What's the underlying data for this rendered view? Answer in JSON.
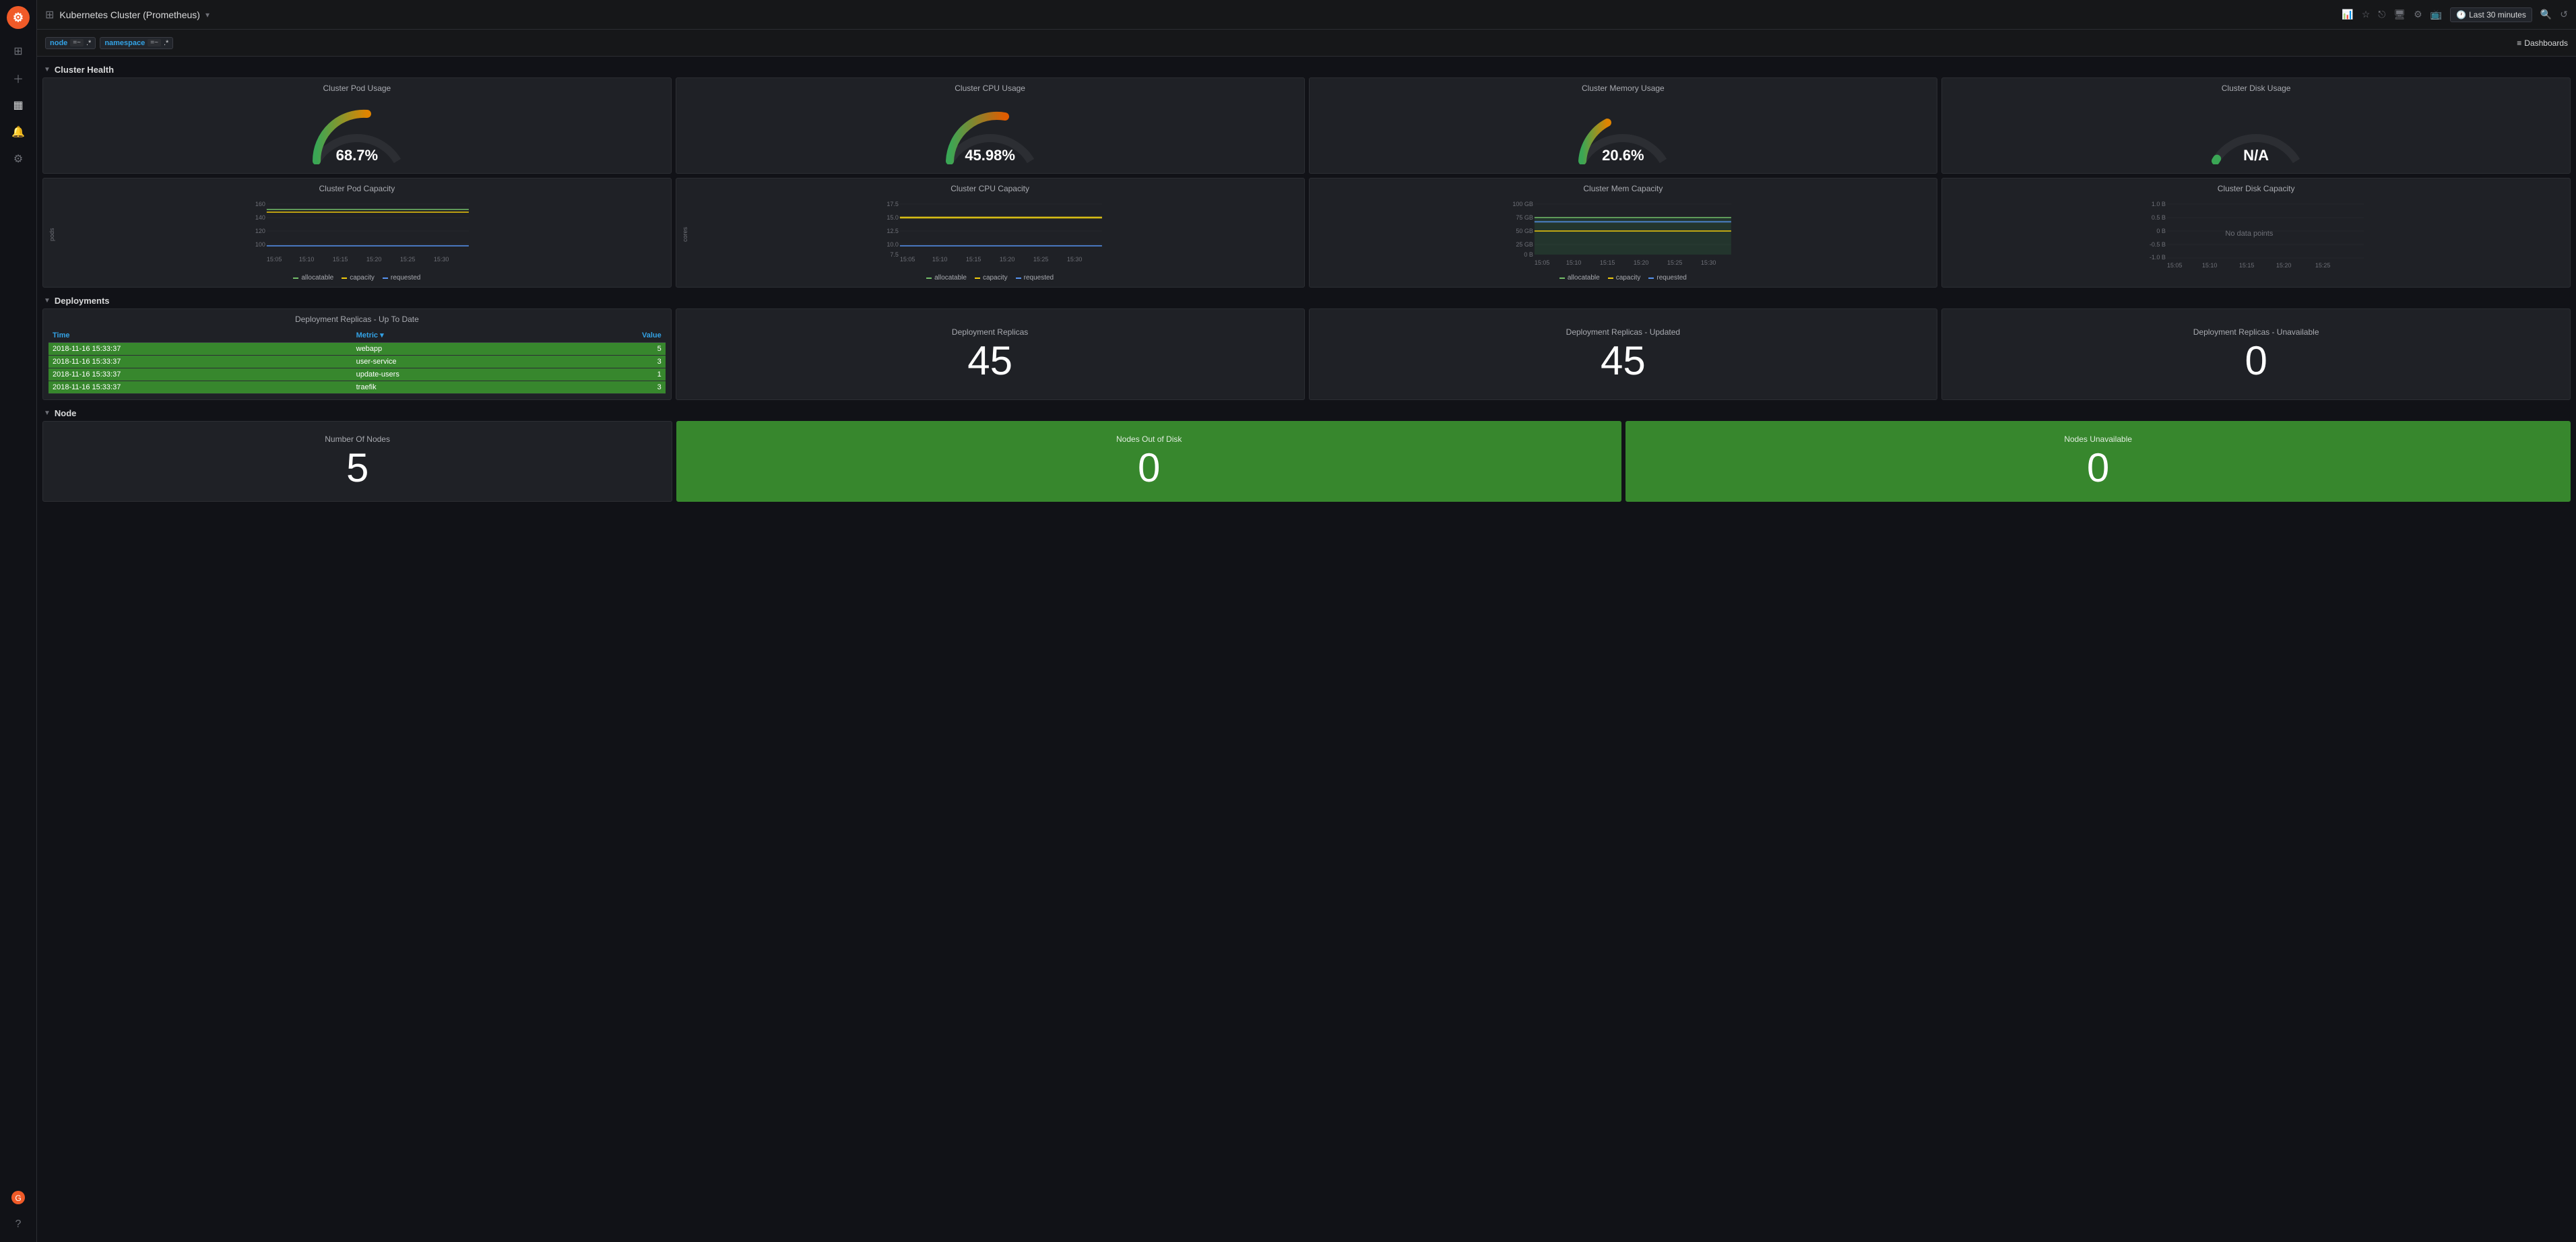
{
  "app": {
    "title": "Kubernetes Cluster (Prometheus)",
    "title_dropdown": "▾",
    "time_range": "Last 30 minutes"
  },
  "sidebar": {
    "icons": [
      "grid",
      "plus",
      "squares",
      "bell",
      "gear",
      "fire-icon",
      "question-icon"
    ]
  },
  "filterbar": {
    "filter1_key": "node",
    "filter1_op": "=~",
    "filter1_val": ".*",
    "filter2_key": "namespace",
    "filter2_op": "=~",
    "filter2_val": ".*",
    "dashboards_label": "Dashboards"
  },
  "sections": {
    "cluster_health": {
      "label": "Cluster Health",
      "gauges": [
        {
          "title": "Cluster Pod Usage",
          "value": "68.7%",
          "pct": 68.7,
          "color_start": "#3aa655",
          "color_end": "#e08400"
        },
        {
          "title": "Cluster CPU Usage",
          "value": "45.98%",
          "pct": 45.98,
          "color_start": "#3aa655",
          "color_end": "#e05c00"
        },
        {
          "title": "Cluster Memory Usage",
          "value": "20.6%",
          "pct": 20.6,
          "color_start": "#3aa655",
          "color_end": "#e08400"
        },
        {
          "title": "Cluster Disk Usage",
          "value": "N/A",
          "pct": null,
          "color_start": "#3aa655",
          "color_end": "#e08400"
        }
      ],
      "charts": [
        {
          "title": "Cluster Pod Capacity",
          "y_axis_label": "pods",
          "y_ticks": [
            "100",
            "120",
            "140",
            "160"
          ],
          "x_ticks": [
            "15:05",
            "15:10",
            "15:15",
            "15:20",
            "15:25",
            "15:30"
          ],
          "legend": [
            {
              "label": "allocatable",
              "color": "#73bf69"
            },
            {
              "label": "capacity",
              "color": "#f2cc0c"
            },
            {
              "label": "requested",
              "color": "#5794f2"
            }
          ]
        },
        {
          "title": "Cluster CPU Capacity",
          "y_axis_label": "cores",
          "y_ticks": [
            "7.5",
            "10.0",
            "12.5",
            "15.0",
            "17.5"
          ],
          "x_ticks": [
            "15:05",
            "15:10",
            "15:15",
            "15:20",
            "15:25",
            "15:30"
          ],
          "legend": [
            {
              "label": "allocatable",
              "color": "#73bf69"
            },
            {
              "label": "capacity",
              "color": "#f2cc0c"
            },
            {
              "label": "requested",
              "color": "#5794f2"
            }
          ]
        },
        {
          "title": "Cluster Mem Capacity",
          "y_axis_label": "",
          "y_ticks": [
            "0 B",
            "25 GB",
            "50 GB",
            "75 GB",
            "100 GB"
          ],
          "x_ticks": [
            "15:05",
            "15:10",
            "15:15",
            "15:20",
            "15:25",
            "15:30"
          ],
          "legend": [
            {
              "label": "allocatable",
              "color": "#73bf69"
            },
            {
              "label": "capacity",
              "color": "#f2cc0c"
            },
            {
              "label": "requested",
              "color": "#5794f2"
            }
          ]
        },
        {
          "title": "Cluster Disk Capacity",
          "y_ticks": [
            "-1.0 B",
            "-0.5 B",
            "0 B",
            "0.5 B",
            "1.0 B"
          ],
          "x_ticks": [
            "15:05",
            "15:10",
            "15:15",
            "15:20",
            "15:25"
          ],
          "no_data": "No data points",
          "legend": []
        }
      ]
    },
    "deployments": {
      "label": "Deployments",
      "table": {
        "title": "Deployment Replicas - Up To Date",
        "columns": [
          "Time",
          "Metric",
          "Value"
        ],
        "rows": [
          {
            "time": "2018-11-16 15:33:37",
            "metric": "webapp",
            "value": "5"
          },
          {
            "time": "2018-11-16 15:33:37",
            "metric": "user-service",
            "value": "3"
          },
          {
            "time": "2018-11-16 15:33:37",
            "metric": "update-users",
            "value": "1"
          },
          {
            "time": "2018-11-16 15:33:37",
            "metric": "traefik",
            "value": "3"
          }
        ]
      },
      "stats": [
        {
          "title": "Deployment Replicas",
          "value": "45"
        },
        {
          "title": "Deployment Replicas - Updated",
          "value": "45"
        },
        {
          "title": "Deployment Replicas - Unavailable",
          "value": "0"
        }
      ]
    },
    "node": {
      "label": "Node",
      "panels": [
        {
          "title": "Number Of Nodes",
          "value": "5",
          "green": false
        },
        {
          "title": "Nodes Out of Disk",
          "value": "0",
          "green": true
        },
        {
          "title": "Nodes Unavailable",
          "value": "0",
          "green": true
        }
      ]
    }
  }
}
